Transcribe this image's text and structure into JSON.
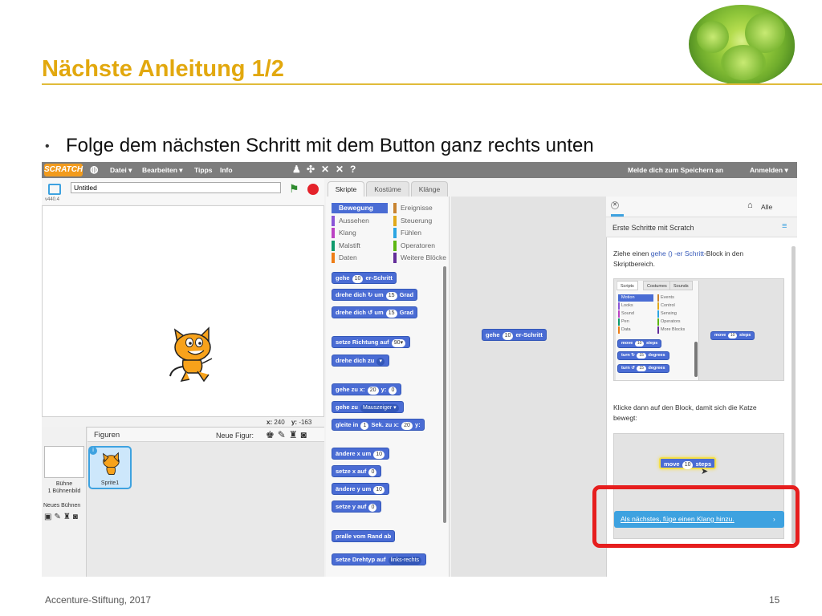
{
  "slide": {
    "title": "Nächste Anleitung 1/2",
    "bullet": "Folge dem nächsten Schritt mit dem Button ganz rechts unten",
    "footer": "Accenture-Stiftung, 2017",
    "page_number": "15"
  },
  "menubar": {
    "logo": "SCRATCH",
    "items": [
      "Datei ▾",
      "Bearbeiten ▾",
      "Tipps",
      "Info"
    ],
    "save_hint": "Melde dich zum Speichern an",
    "login": "Anmelden ▾"
  },
  "stage": {
    "project_title": "Untitled",
    "version": "v440.4",
    "coords_x_label": "x:",
    "coords_x": "240",
    "coords_y_label": "y:",
    "coords_y": "-163"
  },
  "sprites": {
    "header": "Figuren",
    "new_sprite_label": "Neue Figur:",
    "stage_label": "Bühne",
    "backdrop_count": "1 Bühnenbild",
    "new_backdrop": "Neues Bühnen",
    "sprite_name": "Sprite1"
  },
  "tabs": [
    "Skripte",
    "Kostüme",
    "Klänge"
  ],
  "categories_left": [
    "Bewegung",
    "Aussehen",
    "Klang",
    "Malstift",
    "Daten"
  ],
  "categories_right": [
    "Ereignisse",
    "Steuerung",
    "Fühlen",
    "Operatoren",
    "Weitere Blöcke"
  ],
  "category_colors_left": [
    "#4a6cd4",
    "#8a55d7",
    "#bb42c3",
    "#0e9a6c",
    "#ee7d16"
  ],
  "category_colors_right": [
    "#c88330",
    "#e1a91a",
    "#2ca5e2",
    "#5cb712",
    "#632d99"
  ],
  "blocks": {
    "move_pre": "gehe",
    "move_val": "10",
    "move_post": "er-Schritt",
    "turn_right_pre": "drehe dich ↻ um",
    "turn_right_val": "15",
    "turn_right_post": "Grad",
    "turn_left_pre": "drehe dich ↺ um",
    "turn_left_val": "15",
    "turn_left_post": "Grad",
    "point_dir_pre": "setze Richtung auf",
    "point_dir_val": "90▾",
    "point_towards": "drehe dich zu",
    "goto_xy_pre": "gehe zu x:",
    "goto_xy_x": "20",
    "goto_xy_mid": "y:",
    "goto_xy_y": "0",
    "goto_pre": "gehe zu",
    "goto_val": "Mauszeiger ▾",
    "glide_pre": "gleite in",
    "glide_secs": "1",
    "glide_mid": "Sek. zu x:",
    "glide_x": "20",
    "glide_y_label": "y:",
    "change_x_pre": "ändere x um",
    "change_x_val": "10",
    "set_x_pre": "setze x auf",
    "set_x_val": "0",
    "change_y_pre": "ändere y um",
    "change_y_val": "10",
    "set_y_pre": "setze y auf",
    "set_y_val": "0",
    "bounce": "pralle vom Rand ab",
    "rotation_pre": "setze Drehtyp auf",
    "rotation_val": "links-rechts"
  },
  "script_area_block": {
    "pre": "gehe",
    "val": "10",
    "post": "er-Schritt"
  },
  "tips": {
    "all_label": "Alle",
    "header": "Erste Schritte mit Scratch",
    "instruction1_a": "Ziehe einen",
    "instruction1_b": "gehe () -er Schritt",
    "instruction1_c": "-Block in den Skriptbereich.",
    "instruction2": "Klicke dann auf den Block, damit sich die Katze bewegt:",
    "next_button": "Als nächstes, füge einen Klang hinzu.",
    "mini_tabs": [
      "Scripts",
      "Costumes",
      "Sounds"
    ],
    "mini_cats_left": [
      "Motion",
      "Looks",
      "Sound",
      "Pen",
      "Data"
    ],
    "mini_cats_right": [
      "Events",
      "Control",
      "Sensing",
      "Operators",
      "More Blocks"
    ],
    "mini_move": "move",
    "mini_move_val": "10",
    "mini_move_post": "steps",
    "mini_turn_r": "turn ↻",
    "mini_turn_r_val": "15",
    "mini_turn_r_post": "degrees",
    "mini_turn_l": "turn ↺",
    "mini_turn_l_val": "15",
    "mini_turn_l_post": "degrees"
  },
  "colors": {
    "accent_title": "#e2a80e",
    "motion_blue": "#4a6cd4",
    "highlight_red": "#e61e1e",
    "tip_button": "#3ea2e0"
  }
}
